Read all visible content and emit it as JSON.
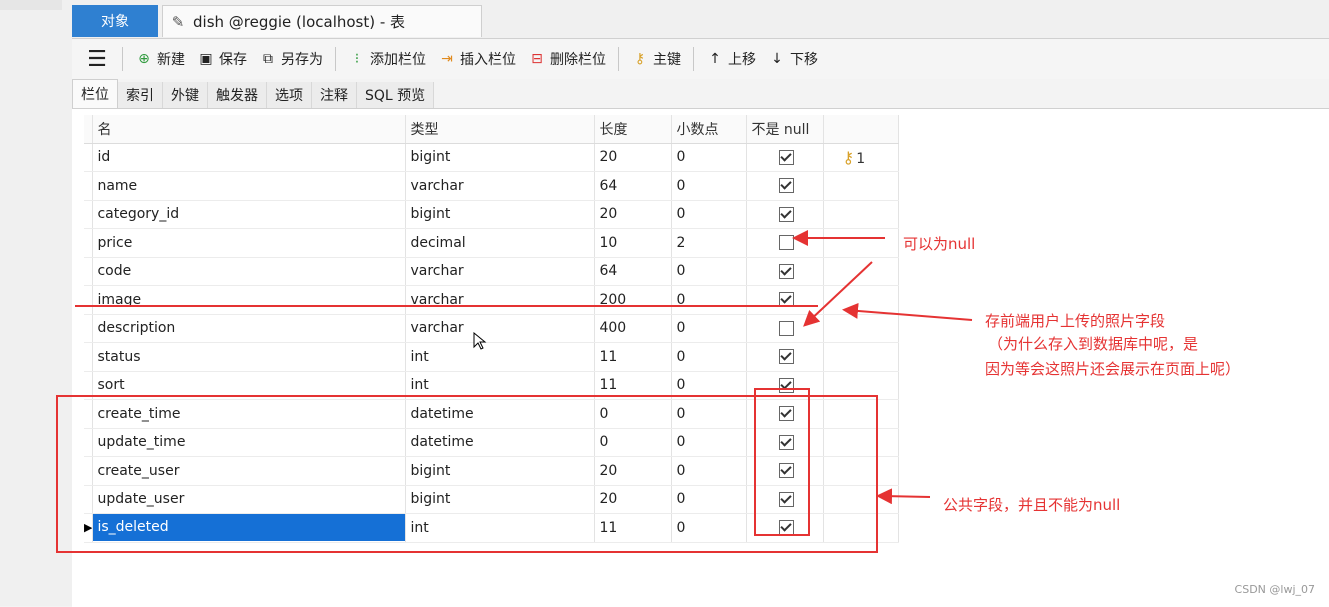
{
  "tabs": {
    "objects": "对象",
    "document_title": "dish @reggie (localhost) - 表"
  },
  "toolbar": {
    "new": "新建",
    "save": "保存",
    "save_as": "另存为",
    "add_field": "添加栏位",
    "insert_field": "插入栏位",
    "delete_field": "删除栏位",
    "primary_key": "主键",
    "move_up": "上移",
    "move_down": "下移"
  },
  "subtabs": [
    "栏位",
    "索引",
    "外键",
    "触发器",
    "选项",
    "注释",
    "SQL 预览"
  ],
  "columns": {
    "name": "名",
    "type": "类型",
    "length": "长度",
    "decimals": "小数点",
    "not_null": "不是 null"
  },
  "rows": [
    {
      "name": "id",
      "type": "bigint",
      "length": "20",
      "decimals": "0",
      "not_null": true,
      "key": "1"
    },
    {
      "name": "name",
      "type": "varchar",
      "length": "64",
      "decimals": "0",
      "not_null": true
    },
    {
      "name": "category_id",
      "type": "bigint",
      "length": "20",
      "decimals": "0",
      "not_null": true
    },
    {
      "name": "price",
      "type": "decimal",
      "length": "10",
      "decimals": "2",
      "not_null": false
    },
    {
      "name": "code",
      "type": "varchar",
      "length": "64",
      "decimals": "0",
      "not_null": true
    },
    {
      "name": "image",
      "type": "varchar",
      "length": "200",
      "decimals": "0",
      "not_null": true
    },
    {
      "name": "description",
      "type": "varchar",
      "length": "400",
      "decimals": "0",
      "not_null": false
    },
    {
      "name": "status",
      "type": "int",
      "length": "11",
      "decimals": "0",
      "not_null": true
    },
    {
      "name": "sort",
      "type": "int",
      "length": "11",
      "decimals": "0",
      "not_null": true
    },
    {
      "name": "create_time",
      "type": "datetime",
      "length": "0",
      "decimals": "0",
      "not_null": true
    },
    {
      "name": "update_time",
      "type": "datetime",
      "length": "0",
      "decimals": "0",
      "not_null": true
    },
    {
      "name": "create_user",
      "type": "bigint",
      "length": "20",
      "decimals": "0",
      "not_null": true
    },
    {
      "name": "update_user",
      "type": "bigint",
      "length": "20",
      "decimals": "0",
      "not_null": true
    },
    {
      "name": "is_deleted",
      "type": "int",
      "length": "11",
      "decimals": "0",
      "not_null": true,
      "selected": true
    }
  ],
  "annotations": {
    "nullable": "可以为null",
    "image_l1": "存前端用户上传的照片字段",
    "image_l2": "（为什么存入到数据库中呢，是",
    "image_l3": "因为等会这照片还会展示在页面上呢）",
    "common": "公共字段，并且不能为null"
  },
  "watermark": "CSDN @lwj_07",
  "colors": {
    "accent": "#2f80d1",
    "annotation": "#e53333",
    "selection": "#1570d6"
  }
}
